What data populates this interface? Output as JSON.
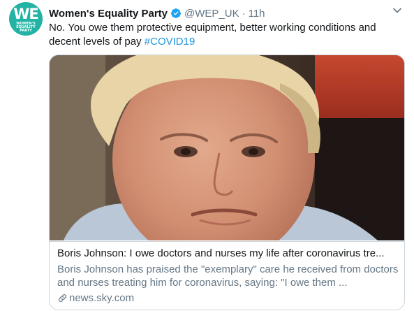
{
  "avatar": {
    "logo_main": "WE",
    "logo_sub": "WOMEN'S EQUALITY PARTY"
  },
  "tweet": {
    "author_name": "Women's Equality Party",
    "handle": "@WEP_UK",
    "separator": "·",
    "time": "11h",
    "text_part1": "No. You owe them protective equipment, better working conditions and decent levels of pay ",
    "hashtag": "#COVID19"
  },
  "card": {
    "title": "Boris Johnson: I owe doctors and nurses my life after coronavirus tre...",
    "description": "Boris Johnson has praised the \"exemplary\" care he received from doctors and nurses treating him for coronavirus, saying: \"I owe them ...",
    "domain": "news.sky.com"
  },
  "colors": {
    "brand_teal": "#22b3a4",
    "link_blue": "#1b95e0",
    "secondary_text": "#657786",
    "border": "#ccd6dd"
  },
  "icons": {
    "verified": "verified-badge-icon",
    "chevron": "chevron-down-icon",
    "link": "link-icon"
  }
}
